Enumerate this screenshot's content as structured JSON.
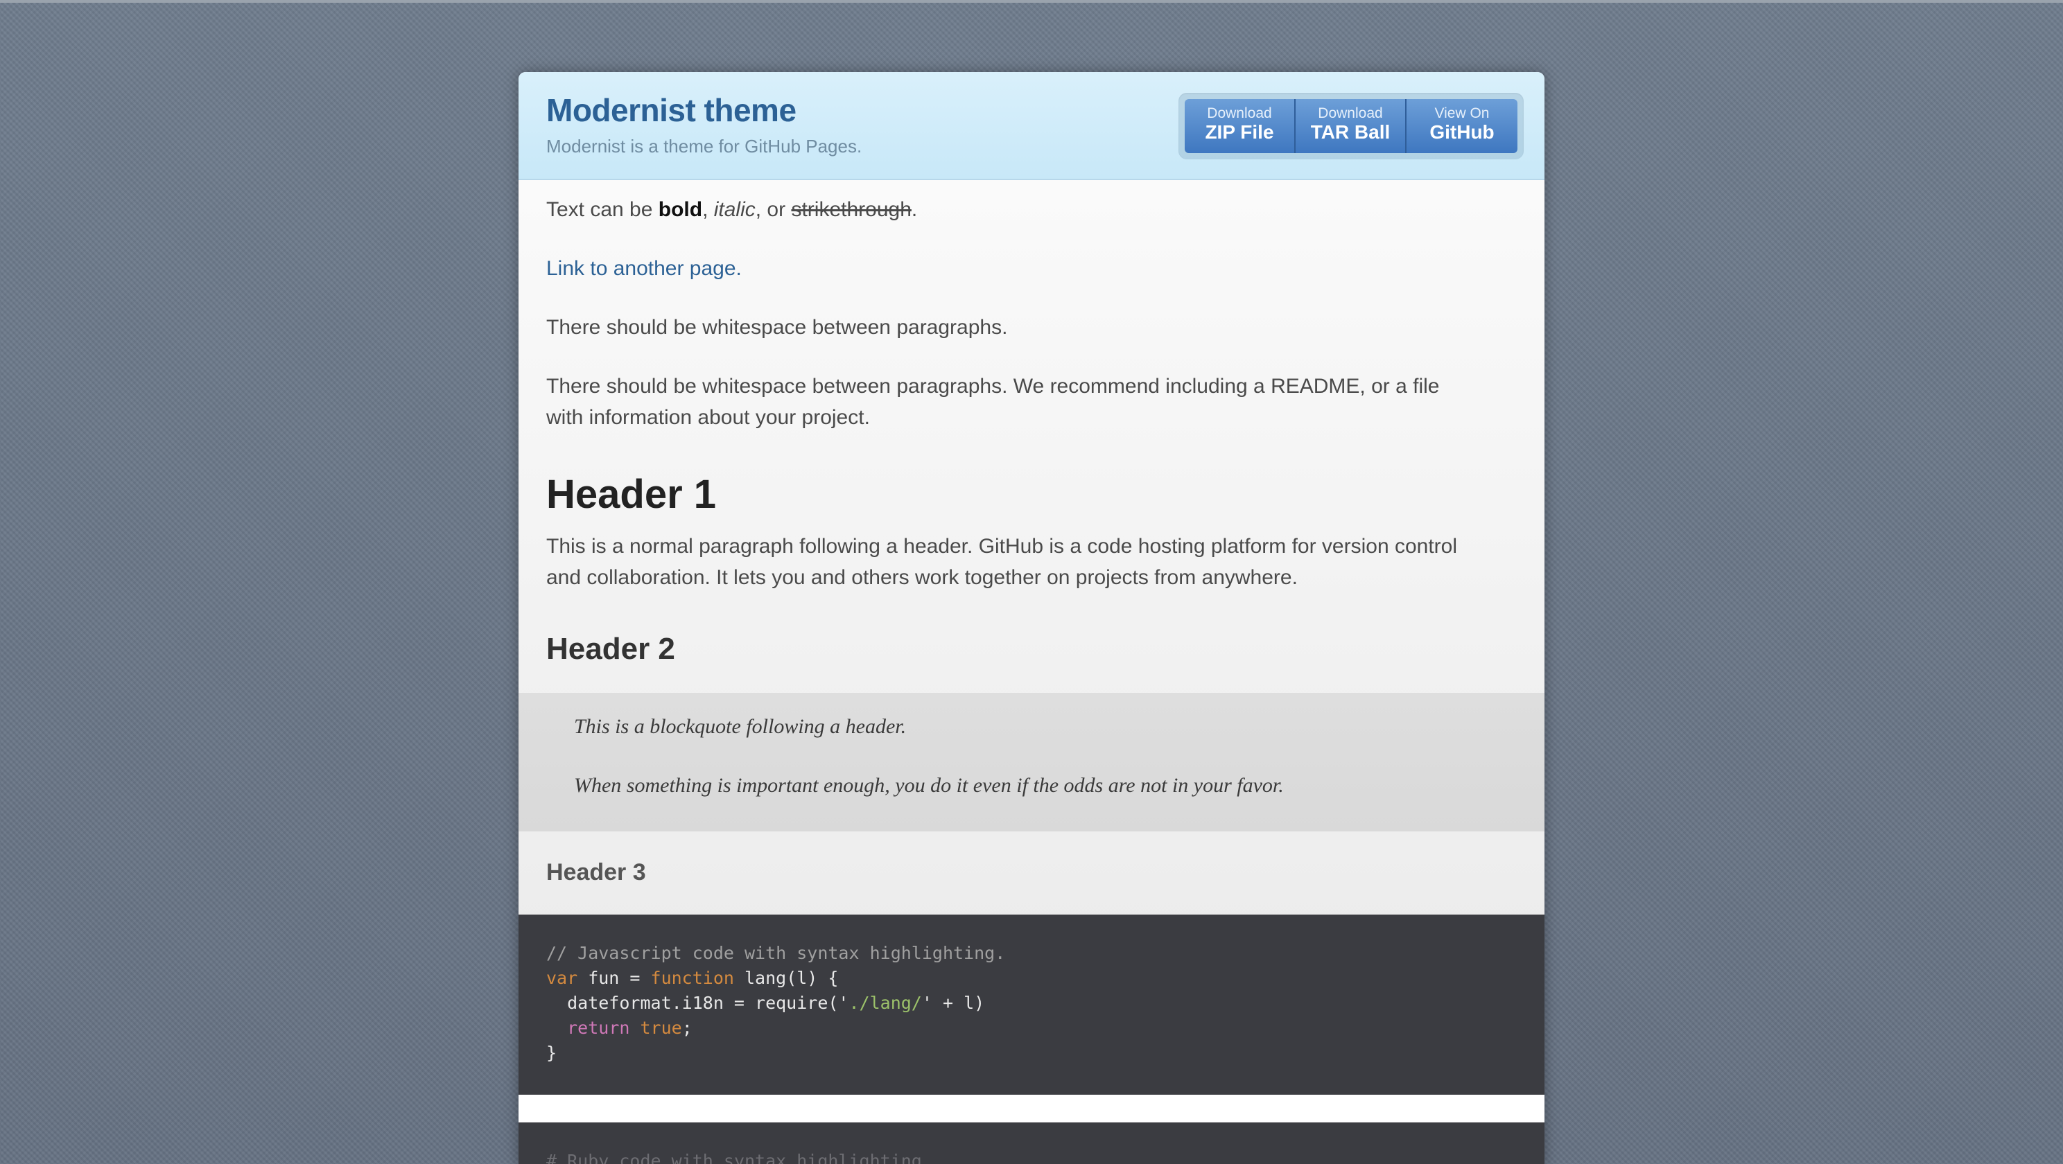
{
  "header": {
    "title": "Modernist theme",
    "tagline": "Modernist is a theme for GitHub Pages.",
    "buttons": [
      {
        "small": "Download",
        "big": "ZIP File"
      },
      {
        "small": "Download",
        "big": "TAR Ball"
      },
      {
        "small": "View On",
        "big": "GitHub"
      }
    ]
  },
  "content": {
    "p1": {
      "prefix": "Text can be ",
      "bold": "bold",
      "sep1": ", ",
      "italic": "italic",
      "sep2": ", or ",
      "strike": "strikethrough",
      "end": "."
    },
    "link": "Link to another page.",
    "p2": "There should be whitespace between paragraphs.",
    "p3": "There should be whitespace between paragraphs. We recommend including a README, or a file with information about your project.",
    "h1": "Header 1",
    "p4": "This is a normal paragraph following a header. GitHub is a code hosting platform for version control and collaboration. It lets you and others work together on projects from anywhere.",
    "h2": "Header 2",
    "blockquote": [
      "This is a blockquote following a header.",
      "When something is important enough, you do it even if the odds are not in your favor."
    ],
    "h3": "Header 3",
    "code1": {
      "comment": "// Javascript code with syntax highlighting.",
      "l2_kw1": "var",
      "l2_mid": " fun = ",
      "l2_kw2": "function",
      "l2_end": " lang(l) {",
      "l3_pre": "  dateformat.i18n = require('",
      "l3_str": "./lang/",
      "l3_end": "' + l)",
      "l4_indent": "  ",
      "l4_kw": "return",
      "l4_sp": " ",
      "l4_val": "true",
      "l4_end": ";",
      "l5": "}"
    },
    "code2": {
      "line": "# Ruby code with syntax highlighting"
    }
  }
}
